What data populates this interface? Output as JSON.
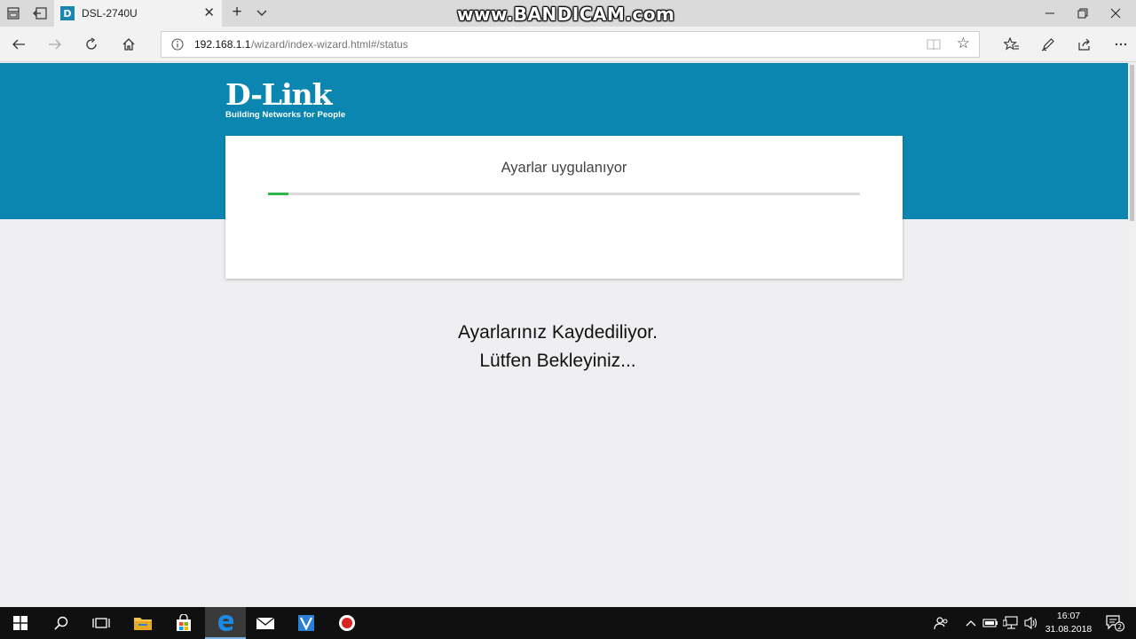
{
  "browser": {
    "tab_title": "DSL-2740U",
    "tab_favicon_letter": "D",
    "url_host": "192.168.1.1",
    "url_path": "/wizard/index-wizard.html#/status"
  },
  "overlay": {
    "watermark": "www.BANDICAM.com"
  },
  "page": {
    "logo_name": "D-Link",
    "logo_tagline": "Building Networks for People",
    "card_title": "Ayarlar uygulanıyor",
    "progress_percent": 3.5,
    "message_line1": "Ayarlarınız Kaydediliyor.",
    "message_line2": "Lütfen Bekleyiniz..."
  },
  "taskbar": {
    "time": "16:07",
    "date": "31.08.2018",
    "notification_count": "2"
  },
  "colors": {
    "banner": "#0b86b0",
    "progress": "#2db84a"
  }
}
